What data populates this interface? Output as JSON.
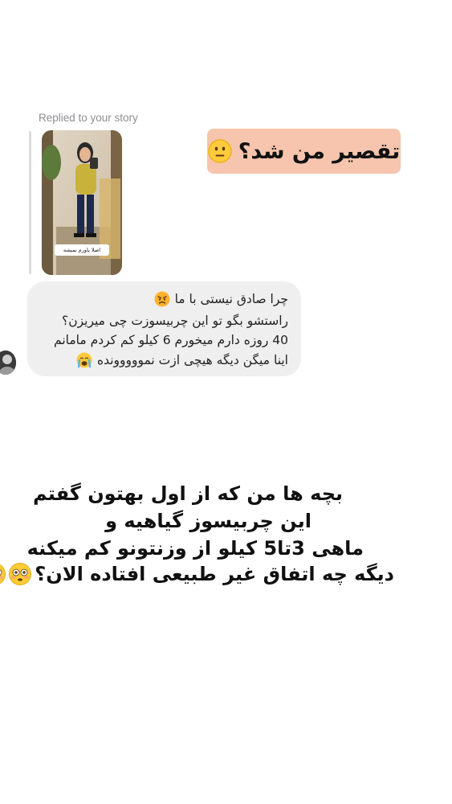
{
  "reply": {
    "label": "Replied to your story",
    "story_caption": "اصلا باورم نمیشه"
  },
  "sticker": {
    "text": "تقصیر من شد؟",
    "emoji_icon": "neutral-face-icon"
  },
  "message": {
    "lines": [
      "چرا صادق نیستی با ما",
      "راستشو بگو تو این چربیسوزت چی میریزن؟",
      "40 روزه دارم میخورم 6 کیلو کم کردم مامانم",
      "اینا میگن دیگه هیچی ازت نمووووونده"
    ],
    "line1_emoji": "angry-face-icon",
    "line4_emoji": "loudly-crying-face-icon"
  },
  "caption": {
    "lines": [
      "بچه ها من که از اول بهتون گفتم",
      "این چربیسوز گیاهیه و",
      "ماهی 3تا5 کیلو از وزنتونو کم میکنه",
      "دیگه چه اتفاق غیر طبیعی افتاده الان؟"
    ],
    "end_emojis": [
      "flushed-face-icon",
      "flushed-face-icon"
    ]
  },
  "colors": {
    "sticker_bg": "#f7c4ad",
    "bubble_bg": "#efefef",
    "meta_text": "#8e8e93"
  }
}
